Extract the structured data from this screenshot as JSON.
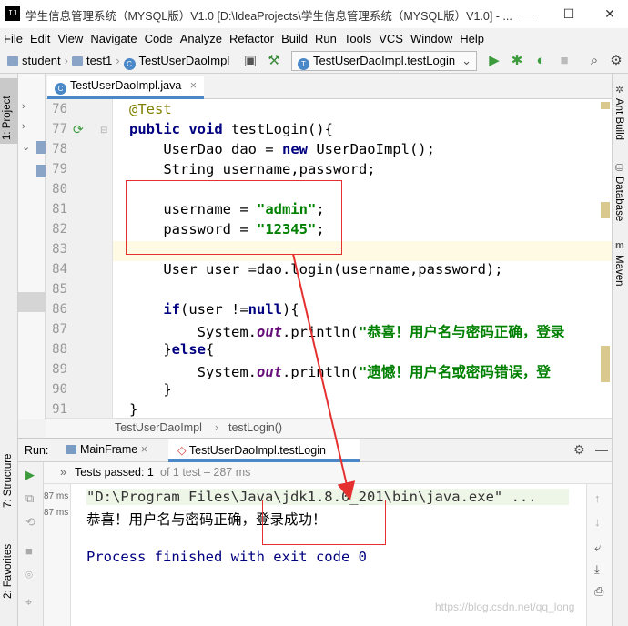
{
  "window": {
    "title": "学生信息管理系统（MYSQL版）V1.0 [D:\\IdeaProjects\\学生信息管理系统（MYSQL版）V1.0] - ...",
    "minimize": "—",
    "maximize": "☐",
    "close": "✕"
  },
  "menu": [
    "File",
    "Edit",
    "View",
    "Navigate",
    "Code",
    "Analyze",
    "Refactor",
    "Build",
    "Run",
    "Tools",
    "VCS",
    "Window",
    "Help"
  ],
  "nav": {
    "project": "student",
    "package": "test1",
    "file": "TestUserDaoImpl",
    "run_config": "TestUserDaoImpl.testLogin"
  },
  "sidebar_left": {
    "project_tab": "1: Project",
    "structure_tab": "7: Structure",
    "favorites_tab": "2: Favorites"
  },
  "sidebar_right": {
    "ant": "Ant Build",
    "database": "Database",
    "maven": "Maven"
  },
  "editor": {
    "tab": "TestUserDaoImpl.java",
    "line_numbers": [
      "76",
      "77",
      "78",
      "79",
      "80",
      "81",
      "82",
      "83",
      "84",
      "85",
      "86",
      "87",
      "88",
      "89",
      "90",
      "91"
    ],
    "breadcrumb": [
      "TestUserDaoImpl",
      "testLogin()"
    ]
  },
  "run": {
    "label": "Run:",
    "tab1": "MainFrame",
    "tab2": "TestUserDaoImpl.testLogin",
    "tests_passed": "Tests passed: 1",
    "tests_detail": "of 1 test – 287 ms",
    "time_1": "87 ms",
    "time_2": "87 ms",
    "console": [
      "\"D:\\Program Files\\Java\\jdk1.8.0_201\\bin\\java.exe\" ...",
      "恭喜！用户名与密码正确，登录成功！",
      "",
      "Process finished with exit code 0"
    ]
  },
  "watermark": "https://blog.csdn.net/qq_long",
  "colors": {
    "keyword": "#000080",
    "string": "#008000",
    "annotation": "#808000",
    "accent": "#4a88c7",
    "highlight_box": "#e53030"
  }
}
